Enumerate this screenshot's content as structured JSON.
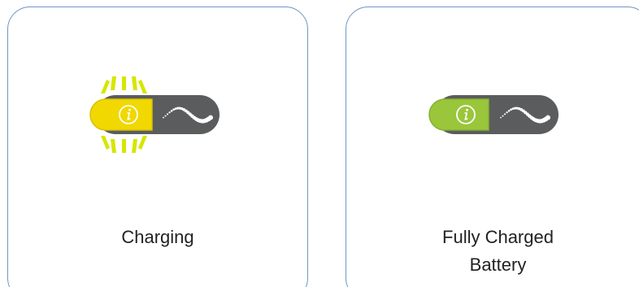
{
  "cards": [
    {
      "caption_lines": [
        "Charging"
      ],
      "state": "charging",
      "led_color": "#f0d800",
      "led_border": "#d7c100",
      "blink_color": "#d6e600",
      "icon": "info-icon",
      "wave_icon": "ac-wave-icon"
    },
    {
      "caption_lines": [
        "Fully Charged",
        "Battery"
      ],
      "state": "fully-charged",
      "led_color": "#9ac63b",
      "led_border": "#86b22f",
      "icon": "info-icon",
      "wave_icon": "ac-wave-icon"
    }
  ],
  "colors": {
    "card_border": "#6f95c4",
    "indicator_body": "#5b5c5e",
    "wave": "#ffffff"
  }
}
